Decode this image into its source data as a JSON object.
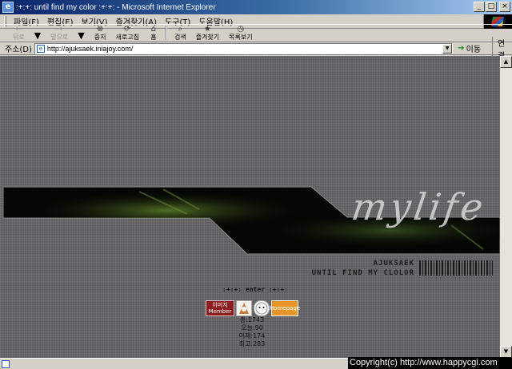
{
  "window": {
    "title": ":+:+: until find my color :+:+: - Microsoft Internet Explorer",
    "controls": {
      "minimize": "_",
      "maximize": "□",
      "close": "×"
    }
  },
  "menu": [
    {
      "label": "파일(F)"
    },
    {
      "label": "편집(E)"
    },
    {
      "label": "보기(V)"
    },
    {
      "label": "즐겨찾기(A)"
    },
    {
      "label": "도구(T)"
    },
    {
      "label": "도움말(H)"
    }
  ],
  "toolbar": [
    {
      "label": "뒤로",
      "icon": "←",
      "disabled": true,
      "dropdown": true
    },
    {
      "label": "앞으로",
      "icon": "→",
      "disabled": true,
      "dropdown": true
    },
    {
      "label": "중지",
      "icon": "⊗",
      "disabled": false
    },
    {
      "label": "새로고침",
      "icon": "⟳",
      "disabled": false
    },
    {
      "label": "홈",
      "icon": "⌂",
      "disabled": false
    },
    {
      "label": "검색",
      "icon": "⌕",
      "disabled": false
    },
    {
      "label": "즐겨찾기",
      "icon": "★",
      "disabled": false
    },
    {
      "label": "목록보기",
      "icon": "◷",
      "disabled": false
    }
  ],
  "address": {
    "label": "주소(D)",
    "url": "http://ajuksaek.iniajoy.com/",
    "go_label": "이동",
    "links_label": "연결"
  },
  "page": {
    "logo_text": "mylife",
    "tag_line1": "AJUKSAEK",
    "tag_line2": "UNTIL FIND MY CLOLOR",
    "enter_text": ":+:+: enter :+:+:",
    "badges": [
      "이미지 Member",
      "",
      "",
      "Homepage"
    ],
    "counter": [
      "총:1743",
      "오늘:90",
      "어제:174",
      "최고:283"
    ]
  },
  "status": {
    "copyright": "Copyright(c) http://www.happycgi.com"
  }
}
